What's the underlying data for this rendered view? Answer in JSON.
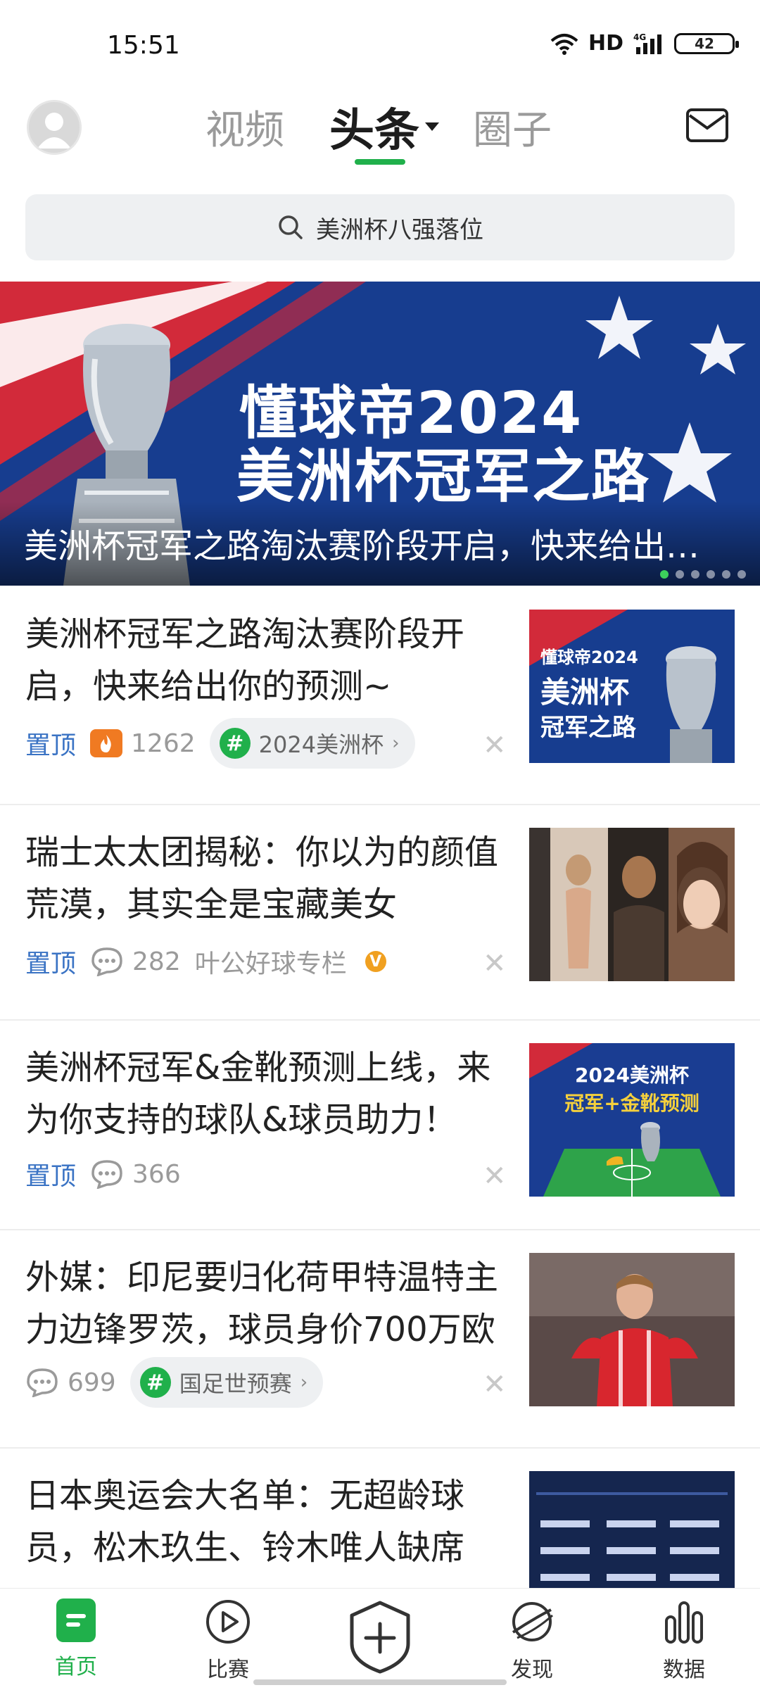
{
  "status_bar": {
    "time": "15:51",
    "network": "HD",
    "signal": "4G",
    "battery": "42"
  },
  "top_nav": {
    "tabs": [
      {
        "label": "视频"
      },
      {
        "label": "头条"
      },
      {
        "label": "圈子"
      }
    ],
    "active_tab": "头条"
  },
  "search": {
    "placeholder": "美洲杯八强落位"
  },
  "banner": {
    "title_line1": "懂球帝2024",
    "title_line2": "美洲杯冠军之路",
    "caption": "美洲杯冠军之路淘汰赛阶段开启，快来给出你的预测~",
    "slide_count": 6,
    "active_slide": 1
  },
  "articles": [
    {
      "title": "美洲杯冠军之路淘汰赛阶段开启，快来给出你的预测~",
      "pin": "置顶",
      "count": "1262",
      "count_type": "fire-icon",
      "topic": "2024美洲杯",
      "thumb_lines": [
        "懂球帝2024",
        "美洲杯",
        "冠军之路"
      ]
    },
    {
      "title": "瑞士太太团揭秘：你以为的颜值荒漠，其实全是宝藏美女",
      "pin": "置顶",
      "count": "282",
      "count_type": "comment-icon",
      "author": "叶公好球专栏",
      "author_badge": "V"
    },
    {
      "title": "美洲杯冠军&金靴预测上线，来为你支持的球队&球员助力！",
      "pin": "置顶",
      "count": "366",
      "count_type": "comment-icon",
      "thumb_lines": [
        "2024美洲杯",
        "冠军+金靴预测"
      ]
    },
    {
      "title": "外媒：印尼要归化荷甲特温特主力边锋罗茨，球员身价700万欧",
      "count": "699",
      "count_type": "comment-icon",
      "topic": "国足世预赛"
    },
    {
      "title": "日本奥运会大名单：无超龄球员，松木玖生、铃木唯人缺席"
    }
  ],
  "bottom_nav": [
    {
      "label": "首页",
      "active": true
    },
    {
      "label": "比赛"
    },
    {
      "label": ""
    },
    {
      "label": "发现"
    },
    {
      "label": "数据"
    }
  ],
  "colors": {
    "accent": "#20b04b",
    "pin": "#3a73c4",
    "banner_bg": "#163a8a",
    "banner_red": "#d22a3a"
  }
}
